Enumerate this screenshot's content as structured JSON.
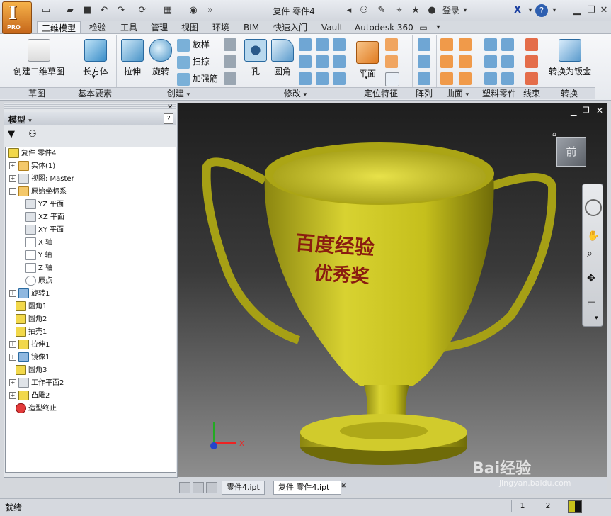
{
  "app": {
    "logo_letter": "I",
    "logo_badge": "PRO",
    "window_title": "复件 零件4",
    "login_label": "登录"
  },
  "tabs": [
    "三维模型",
    "检验",
    "工具",
    "管理",
    "视图",
    "环境",
    "BIM",
    "快速入门",
    "Vault",
    "Autodesk 360"
  ],
  "ribbon": {
    "sketch": {
      "button": "创建二维草图",
      "footer": "草图"
    },
    "basic": {
      "button": "长方体",
      "footer": "基本要素"
    },
    "create": {
      "extrude": "拉伸",
      "revolve": "旋转",
      "loft": "放样",
      "sweep": "扫掠",
      "rib": "加强筋",
      "footer": "创建"
    },
    "modify": {
      "hole": "孔",
      "fillet": "圆角",
      "footer": "修改"
    },
    "work": {
      "plane": "平面",
      "footer": "定位特征"
    },
    "pattern": {
      "footer": "阵列"
    },
    "surface": {
      "footer": "曲面"
    },
    "plastic": {
      "footer": "塑料零件"
    },
    "harness": {
      "footer": "线束"
    },
    "convert": {
      "button": "转换为钣金",
      "footer": "转换"
    }
  },
  "browser": {
    "title": "模型",
    "help": "?",
    "nodes": [
      {
        "label": "复件 零件4",
        "icon": "part"
      },
      {
        "label": "实体(1)",
        "icon": "solid"
      },
      {
        "label": "视图: Master",
        "icon": "view"
      },
      {
        "label": "原始坐标系",
        "icon": "folder"
      },
      {
        "label": "YZ 平面",
        "icon": "plane"
      },
      {
        "label": "XZ 平面",
        "icon": "plane"
      },
      {
        "label": "XY 平面",
        "icon": "plane"
      },
      {
        "label": "X 轴",
        "icon": "axis"
      },
      {
        "label": "Y 轴",
        "icon": "axis"
      },
      {
        "label": "Z 轴",
        "icon": "axis"
      },
      {
        "label": "原点",
        "icon": "point"
      },
      {
        "label": "旋转1",
        "icon": "feature"
      },
      {
        "label": "圆角1",
        "icon": "feature"
      },
      {
        "label": "圆角2",
        "icon": "feature"
      },
      {
        "label": "抽壳1",
        "icon": "feature"
      },
      {
        "label": "拉伸1",
        "icon": "feature"
      },
      {
        "label": "镜像1",
        "icon": "feature"
      },
      {
        "label": "圆角3",
        "icon": "feature"
      },
      {
        "label": "工作平面2",
        "icon": "plane"
      },
      {
        "label": "凸雕2",
        "icon": "feature"
      },
      {
        "label": "造型终止",
        "icon": "error"
      }
    ]
  },
  "viewport": {
    "engraving_line1": "百度经验",
    "engraving_line2": "优秀奖",
    "viewcube_face": "前",
    "axis_x": "X"
  },
  "documents": {
    "tabs": [
      "零件4.ipt",
      "复件 零件4.ipt"
    ],
    "active_index": 1
  },
  "status": {
    "text": "就绪",
    "count1": "1",
    "count2": "2"
  },
  "watermark": {
    "brand": "Bai经验",
    "url": "jingyan.baidu.com"
  },
  "colors": {
    "trophy": "#c8c21a",
    "engraving": "#8a1c10",
    "accent": "#e07b21"
  }
}
